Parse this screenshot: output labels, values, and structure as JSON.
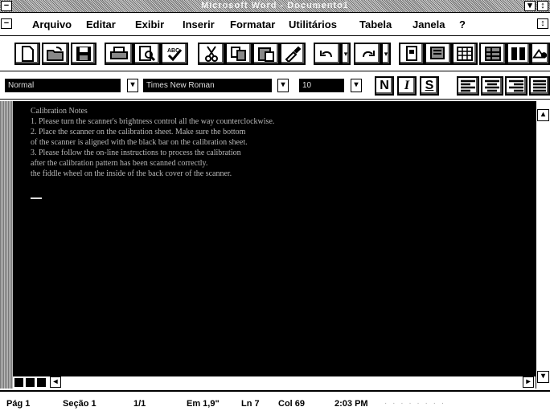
{
  "window": {
    "title": "Microsoft Word - Documento1",
    "sys_menu_glyph": "−",
    "restore_glyph": "↕"
  },
  "menu": [
    {
      "label": "Arquivo"
    },
    {
      "label": "Editar"
    },
    {
      "label": "Exibir"
    },
    {
      "label": "Inserir"
    },
    {
      "label": "Formatar"
    },
    {
      "label": "Utilitários"
    },
    {
      "label": "Tabela"
    },
    {
      "label": "Janela"
    },
    {
      "label": "?"
    }
  ],
  "toolbar": {
    "icons": [
      "new-document-icon",
      "open-folder-icon",
      "save-disk-icon",
      "print-icon",
      "print-preview-icon",
      "spell-check-icon",
      "cut-icon",
      "copy-icon",
      "paste-icon",
      "format-painter-icon",
      "undo-icon",
      "redo-icon",
      "insert-frame-icon",
      "insert-address-icon",
      "insert-table-icon",
      "insert-excel-icon",
      "columns-icon",
      "drawing-icon"
    ]
  },
  "format_bar": {
    "style": "Normal",
    "font": "Times New Roman",
    "size": "10",
    "bold_label": "N",
    "italic_label": "I",
    "underline_label": "S"
  },
  "document": {
    "lines": [
      "Calibration Notes",
      "1. Please turn the scanner's brightness control all the way counterclockwise.",
      "2. Place the scanner on the calibration sheet. Make sure the bottom",
      "of the scanner is aligned with the black bar on the calibration sheet.",
      "3. Please follow the on-line instructions to process the calibration",
      "after the calibration pattern has been scanned correctly.",
      "the fiddle wheel on the inside of the back cover of the scanner."
    ]
  },
  "statusbar": {
    "page": "Pág 1",
    "section": "Seção 1",
    "pages": "1/1",
    "position": "Em 1,9\"",
    "line": "Ln 7",
    "column": "Col 69",
    "time": "2:03 PM"
  },
  "colors": {
    "document_background": "#000000",
    "document_text": "#b8b8b8",
    "chrome": "#ffffff"
  }
}
